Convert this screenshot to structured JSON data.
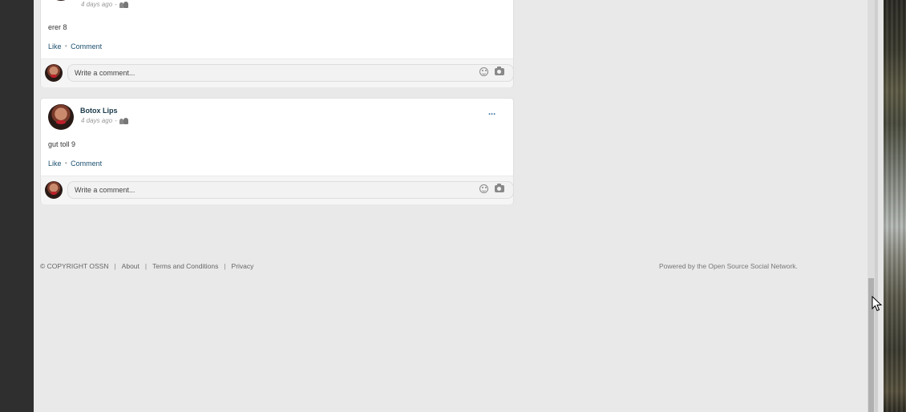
{
  "posts": [
    {
      "author": "",
      "time": "4 days ago",
      "separator": "-",
      "text": "erer 8",
      "actions": {
        "like": "Like",
        "comment": "Comment"
      },
      "comment_placeholder": "Write a comment..."
    },
    {
      "author": "Botox Lips",
      "time": "4 days ago",
      "separator": "-",
      "text": "gut toll 9",
      "actions": {
        "like": "Like",
        "comment": "Comment"
      },
      "comment_placeholder": "Write a comment...",
      "more_menu": "..."
    }
  ],
  "footer": {
    "copyright": "© COPYRIGHT OSSN",
    "links": [
      "About",
      "Terms and Conditions",
      "Privacy"
    ],
    "separator": "|",
    "powered_by": "Powered by the Open Source Social Network."
  },
  "icons": {
    "privacy": "group-icon",
    "emoji": "emoji-icon",
    "camera": "camera-icon",
    "more": "ellipsis-icon"
  },
  "colors": {
    "page_background": "#e9e9e9",
    "card_background": "#ffffff",
    "link": "#1a4f6f",
    "author": "#1a3a4a"
  }
}
